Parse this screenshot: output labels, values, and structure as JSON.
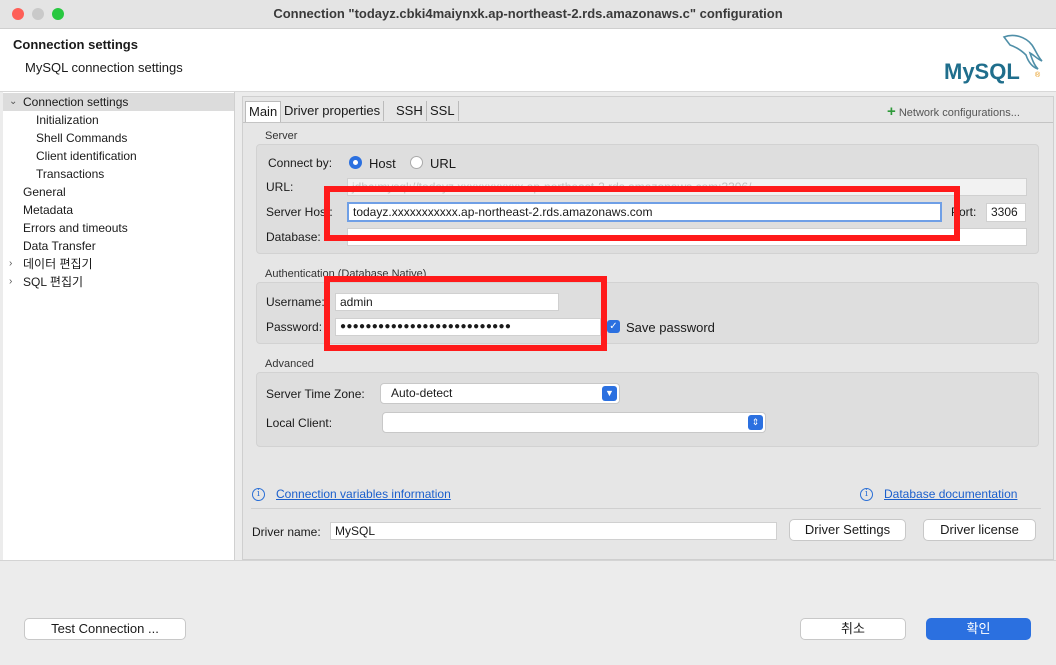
{
  "window": {
    "title": "Connection \"todayz.cbki4maiynxk.ap-northeast-2.rds.amazonaws.c\" configuration",
    "colors": {
      "close": "#fe5f57",
      "minimize": "#febc2e",
      "maximize": "#28c840"
    }
  },
  "header": {
    "title": "Connection settings",
    "subtitle": "MySQL connection settings",
    "logo_text": "MySQL",
    "logo_mark": "®"
  },
  "sidebar": {
    "items": [
      {
        "label": "Connection settings"
      },
      {
        "label": "Initialization"
      },
      {
        "label": "Shell Commands"
      },
      {
        "label": "Client identification"
      },
      {
        "label": "Transactions"
      },
      {
        "label": "General"
      },
      {
        "label": "Metadata"
      },
      {
        "label": "Errors and timeouts"
      },
      {
        "label": "Data Transfer"
      },
      {
        "label": "데이터 편집기"
      },
      {
        "label": "SQL 편집기"
      }
    ]
  },
  "tabs": [
    {
      "label": "Main"
    },
    {
      "label": "Driver properties"
    },
    {
      "label": "SSH"
    },
    {
      "label": "SSL"
    }
  ],
  "network_config": "Network configurations...",
  "server": {
    "section": "Server",
    "connect_by_label": "Connect by:",
    "option_host": "Host",
    "option_url": "URL",
    "url_label": "URL:",
    "url_value": "jdbc:mysql://todayz.xxxxxxxxxxx.ap-northeast-2.rds.amazonaws.com:3306/",
    "host_label": "Server Host:",
    "host_value": "todayz.xxxxxxxxxxx.ap-northeast-2.rds.amazonaws.com",
    "port_label": "Port:",
    "port_value": "3306",
    "database_label": "Database:",
    "database_value": ""
  },
  "auth": {
    "section": "Authentication (Database Native)",
    "username_label": "Username:",
    "username_value": "admin",
    "password_label": "Password:",
    "password_value": "●●●●●●●●●●●●●●●●●●●●●●●●●●●",
    "save_password_label": "Save password"
  },
  "advanced": {
    "section": "Advanced",
    "timezone_label": "Server Time Zone:",
    "timezone_value": "Auto-detect",
    "local_client_label": "Local Client:",
    "local_client_value": ""
  },
  "links": {
    "conn_vars": "Connection variables information",
    "db_docs": "Database documentation"
  },
  "driver": {
    "name_label": "Driver name:",
    "name_value": "MySQL",
    "settings_btn": "Driver Settings",
    "license_btn": "Driver license"
  },
  "footer": {
    "test_btn": "Test Connection ...",
    "cancel_btn": "취소",
    "ok_btn": "확인"
  },
  "accent_color": "#2b70e0",
  "highlight_color": "#ff1a1a"
}
